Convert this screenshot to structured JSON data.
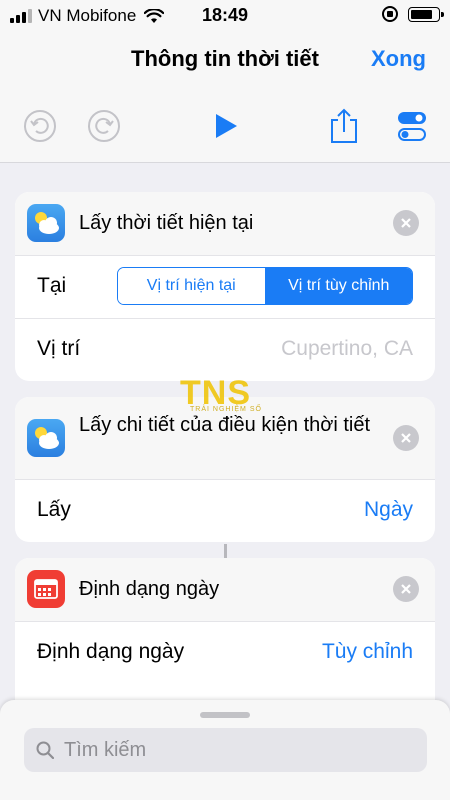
{
  "status_bar": {
    "carrier": "VN Mobifone",
    "time": "18:49",
    "signal_bars_filled": 3,
    "signal_bars_total": 4,
    "battery_level": 0.85
  },
  "nav": {
    "title": "Thông tin thời tiết",
    "done_label": "Xong"
  },
  "toolbar": {
    "icons": [
      "undo-icon",
      "redo-icon",
      "play-icon",
      "share-icon",
      "settings-toggle-icon"
    ]
  },
  "cards": [
    {
      "icon": "weather-icon",
      "title": "Lấy thời tiết hiện tại",
      "rows": [
        {
          "label": "Tại",
          "segments": [
            "Vị trí hiện tại",
            "Vị trí tùy chỉnh"
          ],
          "selected": "Vị trí tùy chỉnh"
        },
        {
          "label": "Vị trí",
          "placeholder": "Cupertino, CA"
        }
      ]
    },
    {
      "icon": "weather-icon",
      "title": "Lấy chi tiết của điều kiện thời tiết",
      "rows": [
        {
          "label": "Lấy",
          "value": "Ngày"
        }
      ]
    },
    {
      "icon": "calendar-icon",
      "title": "Định dạng ngày",
      "rows": [
        {
          "label": "Định dạng ngày",
          "value": "Tùy chỉnh"
        }
      ]
    }
  ],
  "watermark": {
    "letters": "TNS",
    "sub": "TRẢI NGHIỆM SỐ"
  },
  "search": {
    "placeholder": "Tìm kiếm"
  },
  "colors": {
    "accent": "#1a7cf5",
    "background": "#efeff4",
    "calendar_red": "#f03d34"
  }
}
